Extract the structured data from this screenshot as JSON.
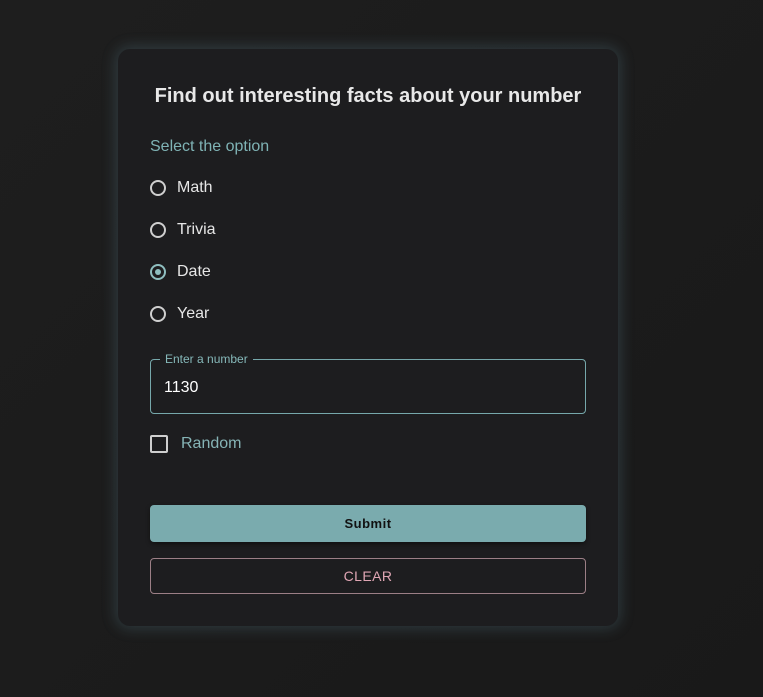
{
  "form": {
    "title": "Find out interesting facts about your number",
    "option_label": "Select the option",
    "options": [
      {
        "label": "Math",
        "checked": false
      },
      {
        "label": "Trivia",
        "checked": false
      },
      {
        "label": "Date",
        "checked": true
      },
      {
        "label": "Year",
        "checked": false
      }
    ],
    "number_field": {
      "label": "Enter a number",
      "value": "1130"
    },
    "random_checkbox": {
      "label": "Random",
      "checked": false
    },
    "submit_label": "Submit",
    "clear_label": "CLEAR"
  },
  "colors": {
    "accent": "#7aabae",
    "clear_border": "#9c7f86",
    "clear_text": "#e0a6b4",
    "background": "#1c1c1c",
    "card": "#1d1d1f"
  }
}
